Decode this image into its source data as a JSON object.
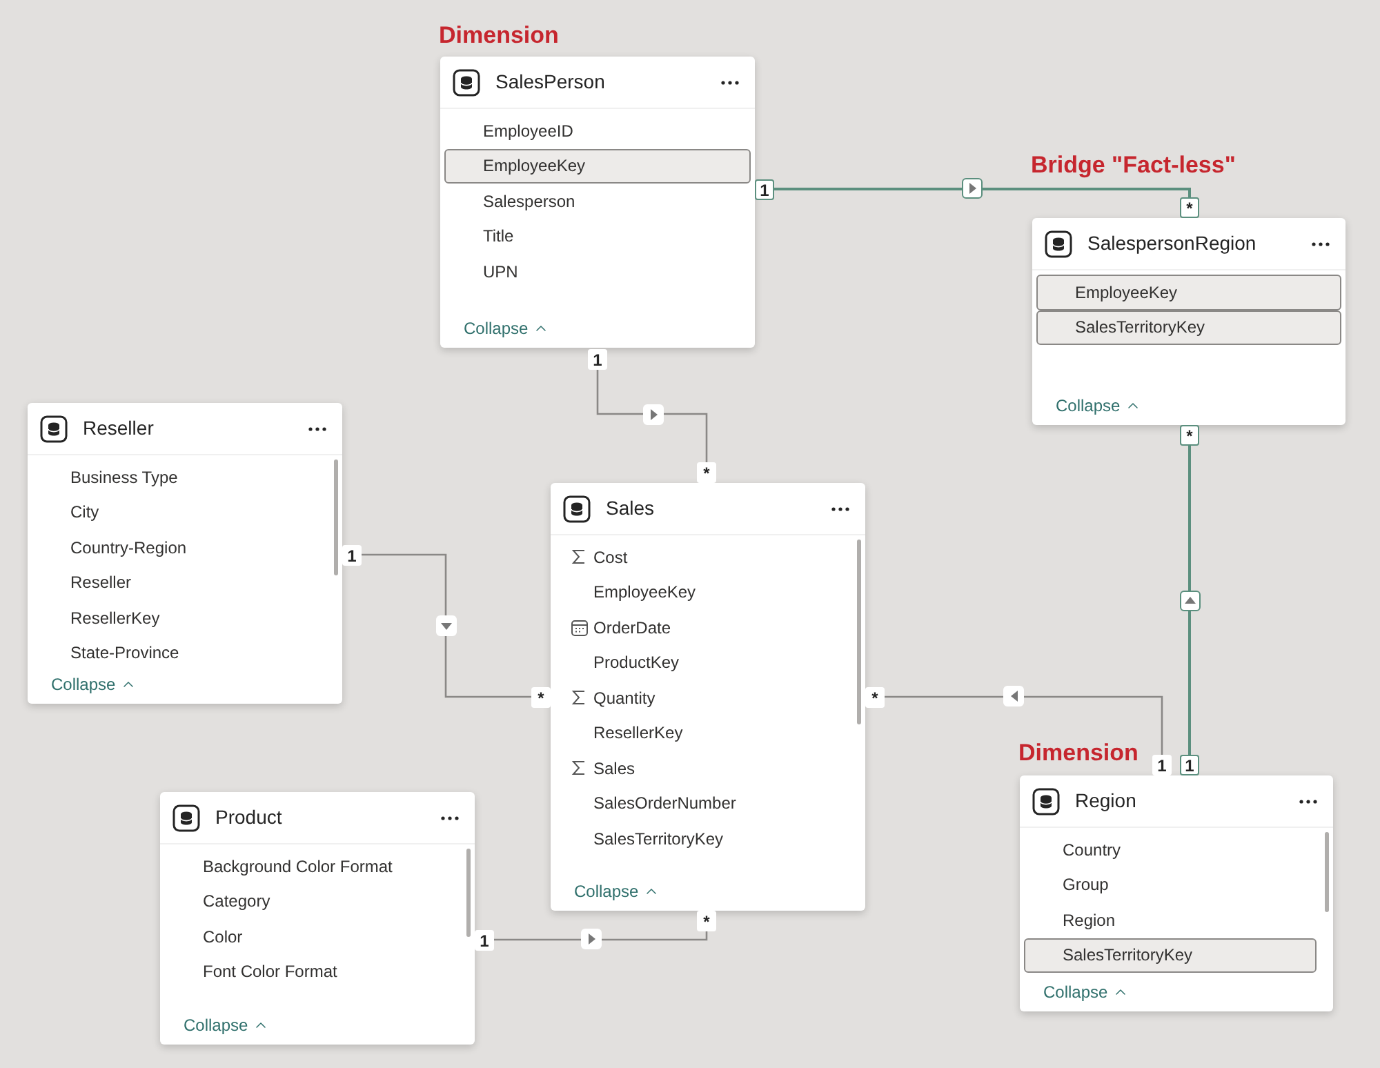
{
  "annotations": [
    {
      "text": "Dimension"
    },
    {
      "text": "Bridge \"Fact-less\""
    },
    {
      "text": "Dimension"
    }
  ],
  "tables": [
    {
      "name": "SalesPerson",
      "scrollable": false,
      "collapse": "Collapse",
      "fields": [
        {
          "name": "EmployeeID",
          "kind": "plain",
          "selected": false
        },
        {
          "name": "EmployeeKey",
          "kind": "plain",
          "selected": true
        },
        {
          "name": "Salesperson",
          "kind": "plain",
          "selected": false
        },
        {
          "name": "Title",
          "kind": "plain",
          "selected": false
        },
        {
          "name": "UPN",
          "kind": "plain",
          "selected": false
        }
      ]
    },
    {
      "name": "SalespersonRegion",
      "scrollable": false,
      "collapse": "Collapse",
      "fields": [
        {
          "name": "EmployeeKey",
          "kind": "plain",
          "selected": true
        },
        {
          "name": "SalesTerritoryKey",
          "kind": "plain",
          "selected": true
        }
      ]
    },
    {
      "name": "Reseller",
      "scrollable": true,
      "collapse": "Collapse",
      "fields": [
        {
          "name": "Business Type",
          "kind": "plain",
          "selected": false
        },
        {
          "name": "City",
          "kind": "plain",
          "selected": false
        },
        {
          "name": "Country-Region",
          "kind": "plain",
          "selected": false
        },
        {
          "name": "Reseller",
          "kind": "plain",
          "selected": false
        },
        {
          "name": "ResellerKey",
          "kind": "plain",
          "selected": false
        },
        {
          "name": "State-Province",
          "kind": "plain",
          "selected": false
        }
      ]
    },
    {
      "name": "Sales",
      "scrollable": true,
      "collapse": "Collapse",
      "fields": [
        {
          "name": "Cost",
          "kind": "sum",
          "selected": false
        },
        {
          "name": "EmployeeKey",
          "kind": "plain",
          "selected": false
        },
        {
          "name": "OrderDate",
          "kind": "date",
          "selected": false
        },
        {
          "name": "ProductKey",
          "kind": "plain",
          "selected": false
        },
        {
          "name": "Quantity",
          "kind": "sum",
          "selected": false
        },
        {
          "name": "ResellerKey",
          "kind": "plain",
          "selected": false
        },
        {
          "name": "Sales",
          "kind": "sum",
          "selected": false
        },
        {
          "name": "SalesOrderNumber",
          "kind": "plain",
          "selected": false
        },
        {
          "name": "SalesTerritoryKey",
          "kind": "plain",
          "selected": false
        }
      ]
    },
    {
      "name": "Product",
      "scrollable": true,
      "collapse": "Collapse",
      "fields": [
        {
          "name": "Background Color Format",
          "kind": "plain",
          "selected": false
        },
        {
          "name": "Category",
          "kind": "plain",
          "selected": false
        },
        {
          "name": "Color",
          "kind": "plain",
          "selected": false
        },
        {
          "name": "Font Color Format",
          "kind": "plain",
          "selected": false
        }
      ]
    },
    {
      "name": "Region",
      "scrollable": true,
      "collapse": "Collapse",
      "fields": [
        {
          "name": "Country",
          "kind": "plain",
          "selected": false
        },
        {
          "name": "Group",
          "kind": "plain",
          "selected": false
        },
        {
          "name": "Region",
          "kind": "plain",
          "selected": false
        },
        {
          "name": "SalesTerritoryKey",
          "kind": "plain",
          "selected": true
        }
      ]
    }
  ],
  "relationships": [
    {
      "from_label": "1",
      "to_label": "*",
      "highlighted": true,
      "kind": "right"
    },
    {
      "from_label": "1",
      "to_label": "*",
      "highlighted": false,
      "kind": "right"
    },
    {
      "from_label": "1",
      "to_label": "*",
      "highlighted": false,
      "kind": "down"
    },
    {
      "from_label": "*",
      "to_label": "1",
      "highlighted": false,
      "kind": "left"
    },
    {
      "from_label": "*",
      "to_label": "1",
      "highlighted": true,
      "kind": "up"
    },
    {
      "from_label": "1",
      "to_label": "*",
      "highlighted": false,
      "kind": "right"
    }
  ]
}
